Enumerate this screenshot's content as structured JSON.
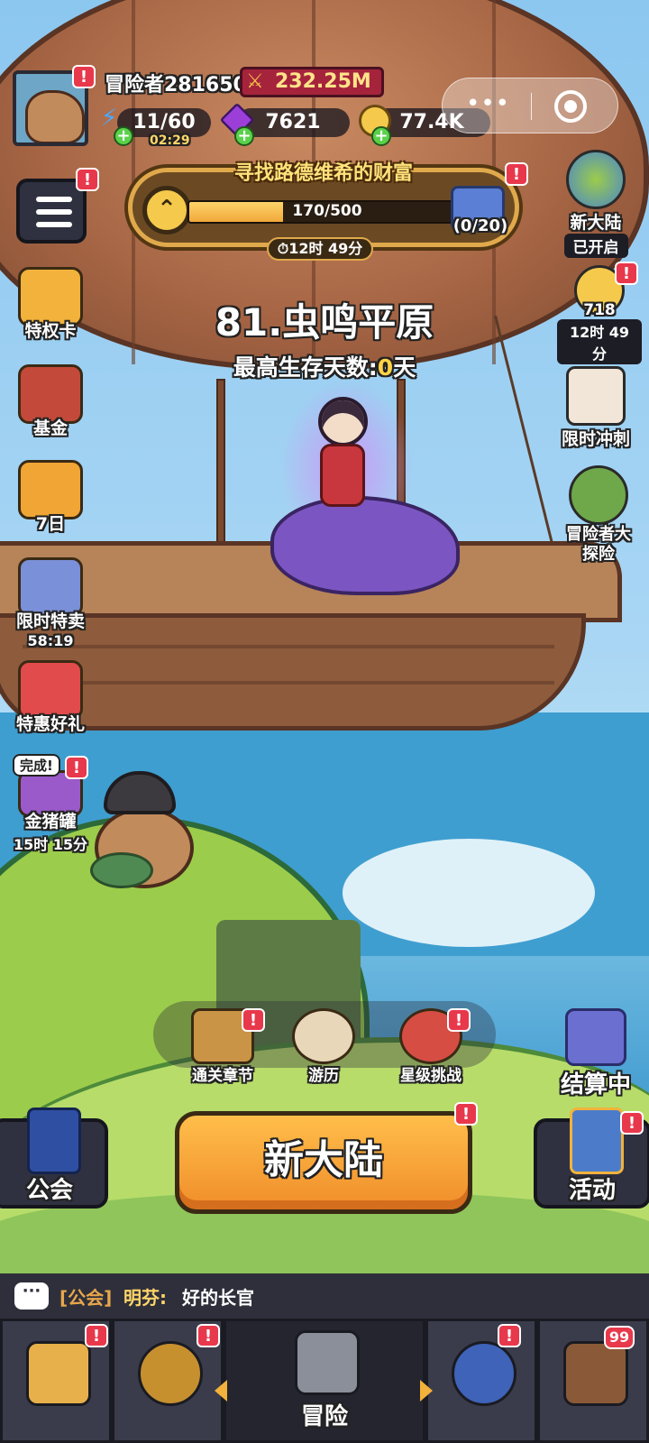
{
  "player": {
    "name": "冒险者281650",
    "power": "232.25M",
    "stamina": "11/60",
    "stamina_timer": "02:29",
    "gems": "7621",
    "gold": "77.4K"
  },
  "quest": {
    "title": "寻找路德维希的财富",
    "progress_text": "170/500",
    "progress_fraction": 0.34,
    "gift_count": "(0/20)",
    "timer": "12时 49分"
  },
  "stage": {
    "name": "81.虫鸣平原",
    "survive_label": "最高生存天数:",
    "survive_value": "0",
    "survive_unit": "天"
  },
  "left_menu": [
    {
      "label": "特权卡",
      "sub": "",
      "color": "#f2b23b"
    },
    {
      "label": "基金",
      "sub": "",
      "color": "#c34a3a"
    },
    {
      "label": "7日",
      "sub": "",
      "color": "#f0a535"
    },
    {
      "label": "限时特卖",
      "sub": "58:19",
      "color": "#7a90d8"
    },
    {
      "label": "特惠好礼",
      "sub": "",
      "color": "#e24b4b"
    },
    {
      "label": "金猪罐",
      "sub": "15时 15分",
      "done": "完成!",
      "color": "#9a5ac9"
    }
  ],
  "right_menu": {
    "new_continent": {
      "label": "新大陆",
      "status": "已开启"
    },
    "star": {
      "value": "718",
      "timer": "12时 49分"
    },
    "rush": {
      "label": "限时冲刺"
    },
    "explore": {
      "label": "冒险者大探险"
    }
  },
  "hud": {
    "chapters": "通关章节",
    "travel": "游历",
    "star_challenge": "星级挑战",
    "settling": "结算中"
  },
  "actions": {
    "guild": "公会",
    "main": "新大陆",
    "events": "活动"
  },
  "chat": {
    "channel": "[公会]",
    "sender": "明芬:",
    "message": "好的长官"
  },
  "tabs": {
    "center_label": "冒险",
    "chest_count": "99"
  },
  "badge_mark": "!",
  "colors": {
    "alert": "#e8384c",
    "accent_orange": "#f08d2a",
    "gold_text": "#ffe27a"
  }
}
